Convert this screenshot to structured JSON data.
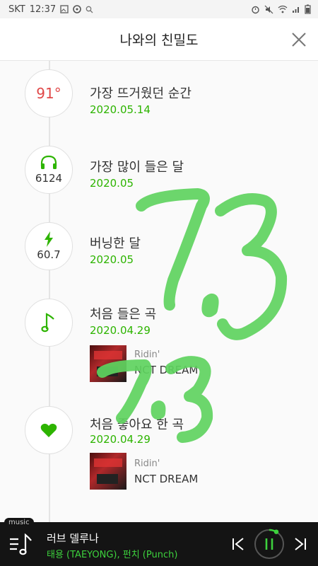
{
  "statusbar": {
    "carrier": "SKT",
    "time": "12:37"
  },
  "header": {
    "title": "나와의 친밀도"
  },
  "items": [
    {
      "circle_value": "91°",
      "label": "가장 뜨거웠던 순간",
      "date": "2020.05.14"
    },
    {
      "circle_value": "6124",
      "label": "가장 많이 들은 달",
      "date": "2020.05"
    },
    {
      "circle_value": "60.7",
      "label": "버닝한 달",
      "date": "2020.05"
    },
    {
      "label": "처음 들은 곡",
      "date": "2020.04.29",
      "song_title": "Ridin'",
      "song_artist": "NCT DREAM"
    },
    {
      "label": "처음 좋아요 한 곡",
      "date": "2020.04.29",
      "song_title": "Ridin'",
      "song_artist": "NCT DREAM"
    }
  ],
  "player": {
    "badge": "music",
    "track": "러브 델루나",
    "artist": "태용 (TAEYONG), 펀치 (Punch)"
  },
  "colors": {
    "accent": "#2db400",
    "temp": "#e04848",
    "scribble": "#5fd35f"
  }
}
